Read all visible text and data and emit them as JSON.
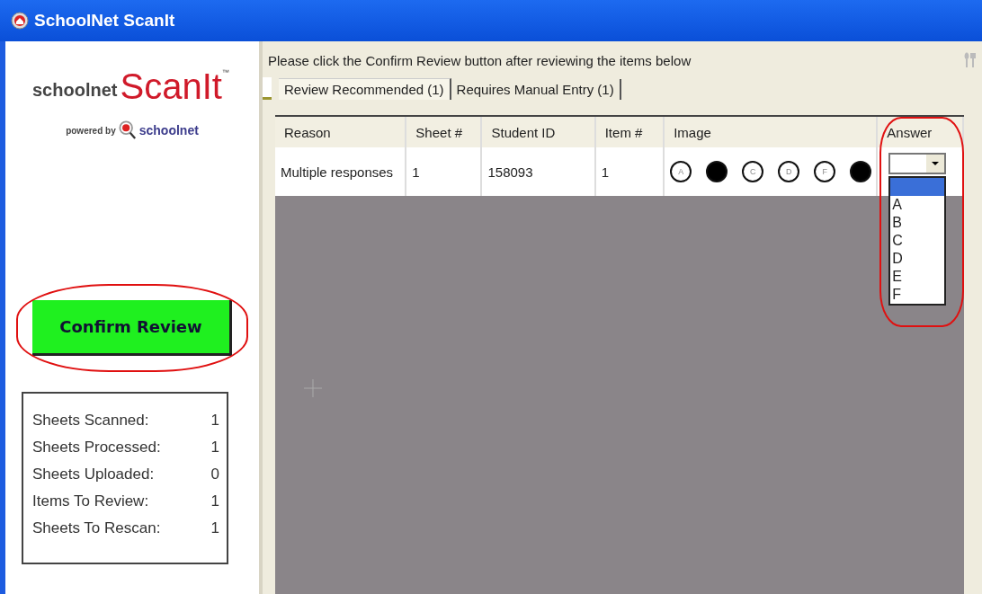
{
  "window": {
    "title": "SchoolNet ScanIt"
  },
  "logo": {
    "brand": "schoolnet",
    "product": "ScanIt",
    "trademark": "™",
    "powered_by": "powered by",
    "powered_brand": "schoolnet"
  },
  "confirm_button": {
    "label": "Confirm Review",
    "highlighted": true
  },
  "stats": [
    {
      "label": "Sheets Scanned:",
      "value": "1"
    },
    {
      "label": "Sheets Processed:",
      "value": "1"
    },
    {
      "label": "Sheets Uploaded:",
      "value": "0"
    },
    {
      "label": "Items To Review:",
      "value": "1"
    },
    {
      "label": "Sheets To Rescan:",
      "value": "1"
    }
  ],
  "instruction": "Please click the Confirm Review button after reviewing the items below",
  "tabs": [
    {
      "label": "Review Recommended (1)",
      "selected": true
    },
    {
      "label": "Requires Manual Entry (1)",
      "selected": false
    }
  ],
  "table": {
    "columns": [
      "Reason",
      "Sheet #",
      "Student ID",
      "Item #",
      "Image",
      "Answer"
    ],
    "answer_highlighted": true,
    "rows": [
      {
        "reason": "Multiple responses",
        "sheet": "1",
        "student_id": "158093",
        "item": "1",
        "bubbles": [
          {
            "label": "A",
            "filled": false
          },
          {
            "filled": true
          },
          {
            "label": "C",
            "filled": false
          },
          {
            "label": "D",
            "filled": false
          },
          {
            "label": "F",
            "filled": false
          },
          {
            "filled": true
          }
        ],
        "answer": {
          "expanded": true,
          "options": [
            {
              "selected": true
            },
            {
              "label": "A",
              "selected": false
            },
            {
              "label": "B",
              "selected": false
            },
            {
              "label": "C",
              "selected": false
            },
            {
              "label": "D",
              "selected": false
            },
            {
              "label": "E",
              "selected": false
            },
            {
              "label": "F",
              "selected": false
            }
          ]
        }
      }
    ]
  }
}
